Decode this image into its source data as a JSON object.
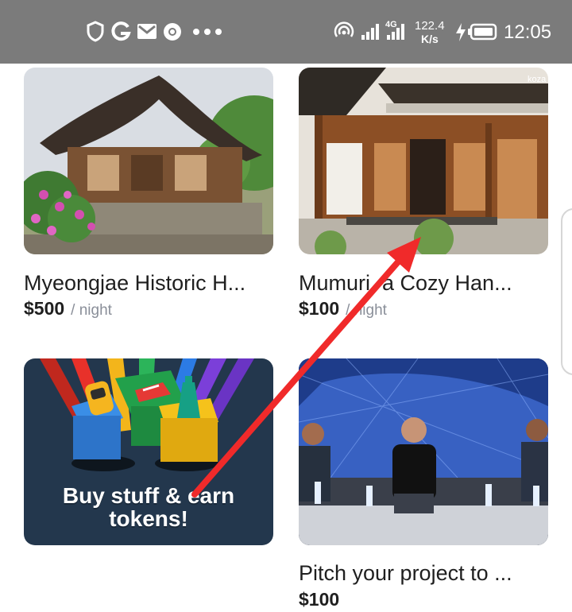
{
  "status_bar": {
    "network_type": "4G",
    "speed_value": "122.4",
    "speed_unit": "K/s",
    "time": "12:05",
    "notification_icons": [
      "shield-icon",
      "google-icon",
      "gmail-icon",
      "chrome-icon",
      "more-dots-icon"
    ]
  },
  "listings": [
    {
      "title": "Myeongjae Historic H...",
      "price": "$500",
      "unit": "/ night"
    },
    {
      "title": "Mumuri, a Cozy Han...",
      "price": "$100",
      "unit": "/ night"
    },
    {
      "title": "Pitch your project to ...",
      "price": "$100"
    }
  ],
  "promo": {
    "line1": "Buy stuff & earn",
    "line2": "tokens!"
  },
  "image_watermark": "koza",
  "colors": {
    "status_bar_bg": "#7b7b7b",
    "promo_bg": "#23374d",
    "arrow": "#f02a2a"
  }
}
